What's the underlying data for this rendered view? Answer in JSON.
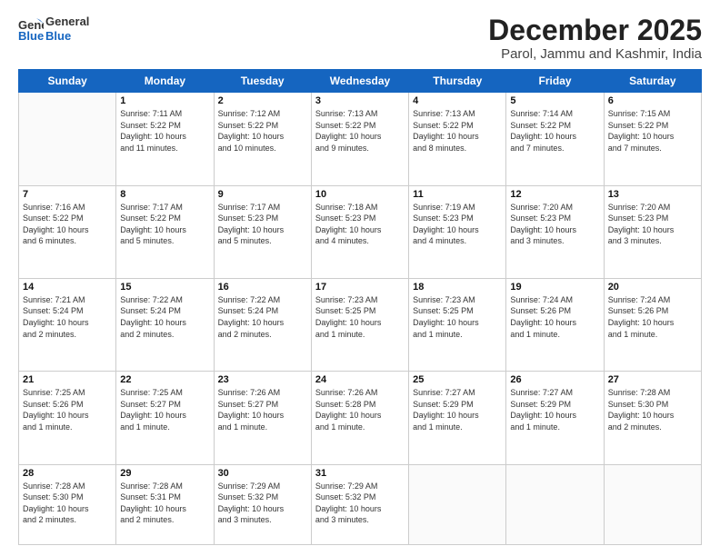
{
  "logo": {
    "line1": "General",
    "line2": "Blue"
  },
  "header": {
    "month": "December 2025",
    "location": "Parol, Jammu and Kashmir, India"
  },
  "weekdays": [
    "Sunday",
    "Monday",
    "Tuesday",
    "Wednesday",
    "Thursday",
    "Friday",
    "Saturday"
  ],
  "weeks": [
    [
      {
        "day": "",
        "info": ""
      },
      {
        "day": "1",
        "info": "Sunrise: 7:11 AM\nSunset: 5:22 PM\nDaylight: 10 hours\nand 11 minutes."
      },
      {
        "day": "2",
        "info": "Sunrise: 7:12 AM\nSunset: 5:22 PM\nDaylight: 10 hours\nand 10 minutes."
      },
      {
        "day": "3",
        "info": "Sunrise: 7:13 AM\nSunset: 5:22 PM\nDaylight: 10 hours\nand 9 minutes."
      },
      {
        "day": "4",
        "info": "Sunrise: 7:13 AM\nSunset: 5:22 PM\nDaylight: 10 hours\nand 8 minutes."
      },
      {
        "day": "5",
        "info": "Sunrise: 7:14 AM\nSunset: 5:22 PM\nDaylight: 10 hours\nand 7 minutes."
      },
      {
        "day": "6",
        "info": "Sunrise: 7:15 AM\nSunset: 5:22 PM\nDaylight: 10 hours\nand 7 minutes."
      }
    ],
    [
      {
        "day": "7",
        "info": "Sunrise: 7:16 AM\nSunset: 5:22 PM\nDaylight: 10 hours\nand 6 minutes."
      },
      {
        "day": "8",
        "info": "Sunrise: 7:17 AM\nSunset: 5:22 PM\nDaylight: 10 hours\nand 5 minutes."
      },
      {
        "day": "9",
        "info": "Sunrise: 7:17 AM\nSunset: 5:23 PM\nDaylight: 10 hours\nand 5 minutes."
      },
      {
        "day": "10",
        "info": "Sunrise: 7:18 AM\nSunset: 5:23 PM\nDaylight: 10 hours\nand 4 minutes."
      },
      {
        "day": "11",
        "info": "Sunrise: 7:19 AM\nSunset: 5:23 PM\nDaylight: 10 hours\nand 4 minutes."
      },
      {
        "day": "12",
        "info": "Sunrise: 7:20 AM\nSunset: 5:23 PM\nDaylight: 10 hours\nand 3 minutes."
      },
      {
        "day": "13",
        "info": "Sunrise: 7:20 AM\nSunset: 5:23 PM\nDaylight: 10 hours\nand 3 minutes."
      }
    ],
    [
      {
        "day": "14",
        "info": "Sunrise: 7:21 AM\nSunset: 5:24 PM\nDaylight: 10 hours\nand 2 minutes."
      },
      {
        "day": "15",
        "info": "Sunrise: 7:22 AM\nSunset: 5:24 PM\nDaylight: 10 hours\nand 2 minutes."
      },
      {
        "day": "16",
        "info": "Sunrise: 7:22 AM\nSunset: 5:24 PM\nDaylight: 10 hours\nand 2 minutes."
      },
      {
        "day": "17",
        "info": "Sunrise: 7:23 AM\nSunset: 5:25 PM\nDaylight: 10 hours\nand 1 minute."
      },
      {
        "day": "18",
        "info": "Sunrise: 7:23 AM\nSunset: 5:25 PM\nDaylight: 10 hours\nand 1 minute."
      },
      {
        "day": "19",
        "info": "Sunrise: 7:24 AM\nSunset: 5:26 PM\nDaylight: 10 hours\nand 1 minute."
      },
      {
        "day": "20",
        "info": "Sunrise: 7:24 AM\nSunset: 5:26 PM\nDaylight: 10 hours\nand 1 minute."
      }
    ],
    [
      {
        "day": "21",
        "info": "Sunrise: 7:25 AM\nSunset: 5:26 PM\nDaylight: 10 hours\nand 1 minute."
      },
      {
        "day": "22",
        "info": "Sunrise: 7:25 AM\nSunset: 5:27 PM\nDaylight: 10 hours\nand 1 minute."
      },
      {
        "day": "23",
        "info": "Sunrise: 7:26 AM\nSunset: 5:27 PM\nDaylight: 10 hours\nand 1 minute."
      },
      {
        "day": "24",
        "info": "Sunrise: 7:26 AM\nSunset: 5:28 PM\nDaylight: 10 hours\nand 1 minute."
      },
      {
        "day": "25",
        "info": "Sunrise: 7:27 AM\nSunset: 5:29 PM\nDaylight: 10 hours\nand 1 minute."
      },
      {
        "day": "26",
        "info": "Sunrise: 7:27 AM\nSunset: 5:29 PM\nDaylight: 10 hours\nand 1 minute."
      },
      {
        "day": "27",
        "info": "Sunrise: 7:28 AM\nSunset: 5:30 PM\nDaylight: 10 hours\nand 2 minutes."
      }
    ],
    [
      {
        "day": "28",
        "info": "Sunrise: 7:28 AM\nSunset: 5:30 PM\nDaylight: 10 hours\nand 2 minutes."
      },
      {
        "day": "29",
        "info": "Sunrise: 7:28 AM\nSunset: 5:31 PM\nDaylight: 10 hours\nand 2 minutes."
      },
      {
        "day": "30",
        "info": "Sunrise: 7:29 AM\nSunset: 5:32 PM\nDaylight: 10 hours\nand 3 minutes."
      },
      {
        "day": "31",
        "info": "Sunrise: 7:29 AM\nSunset: 5:32 PM\nDaylight: 10 hours\nand 3 minutes."
      },
      {
        "day": "",
        "info": ""
      },
      {
        "day": "",
        "info": ""
      },
      {
        "day": "",
        "info": ""
      }
    ]
  ]
}
